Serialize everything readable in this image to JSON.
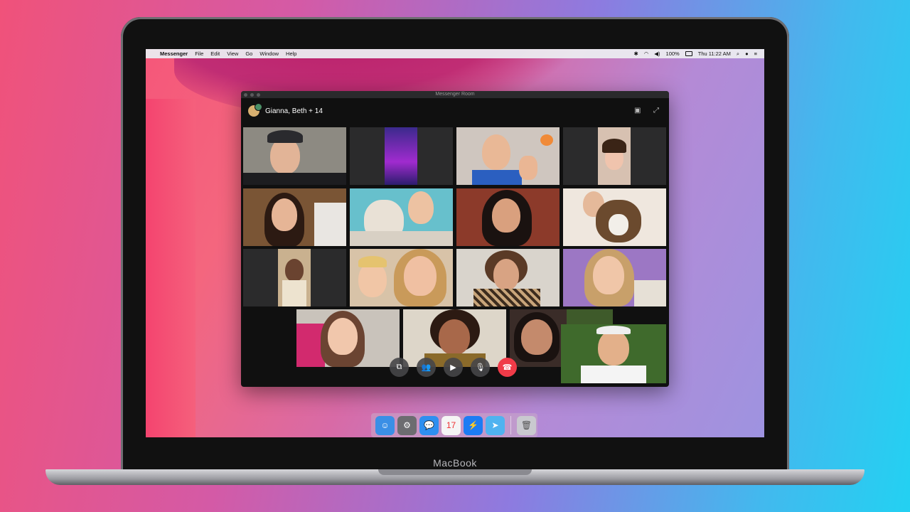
{
  "menubar": {
    "apple_icon": "apple-icon",
    "app_name": "Messenger",
    "menus": [
      "File",
      "Edit",
      "View",
      "Go",
      "Window",
      "Help"
    ],
    "battery": "100%",
    "clock": "Thu 11:22 AM"
  },
  "window": {
    "title": "Messenger Room",
    "room_name": "Gianna, Beth + 14"
  },
  "colors": {
    "hangup": "#f03b48",
    "accent_pink": "#f4466f",
    "window_bg": "#101010"
  },
  "controls": [
    {
      "name": "share-screen-button",
      "icon": "share-screen-icon",
      "glyph": "⧉"
    },
    {
      "name": "participants-button",
      "icon": "people-icon",
      "glyph": "👥"
    },
    {
      "name": "camera-button",
      "icon": "video-camera-icon",
      "glyph": "▶"
    },
    {
      "name": "mic-button",
      "icon": "microphone-icon",
      "glyph": "🎙"
    },
    {
      "name": "end-call-button",
      "icon": "hang-up-icon",
      "glyph": "☎"
    }
  ],
  "dock": [
    {
      "name": "finder-icon",
      "glyph": "☺",
      "color": "#3a8fe6"
    },
    {
      "name": "system-preferences-icon",
      "glyph": "⚙",
      "color": "#6c6c70"
    },
    {
      "name": "messages-icon",
      "glyph": "💬",
      "color": "#2e8ff0"
    },
    {
      "name": "calendar-icon",
      "glyph": "17",
      "color": "#f5f5f5"
    },
    {
      "name": "messenger-icon",
      "glyph": "⚡",
      "color": "#1c7cf4"
    },
    {
      "name": "maps-icon",
      "glyph": "➤",
      "color": "#4fb3f0"
    },
    {
      "name": "trash-icon",
      "glyph": "🗑",
      "color": "#c9c9cf"
    }
  ],
  "laptop": {
    "brand": "MacBook"
  }
}
